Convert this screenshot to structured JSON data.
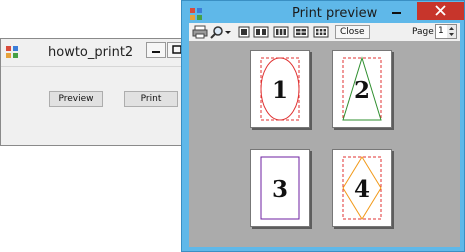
{
  "main_window": {
    "title": "howto_print2",
    "buttons": {
      "preview": "Preview",
      "print": "Print"
    }
  },
  "preview_window": {
    "title": "Print preview",
    "toolbar": {
      "close_label": "Close",
      "page_label": "Page",
      "page_value": "1"
    },
    "pages": [
      {
        "number": "1",
        "shape": "ellipse",
        "color": "#e03030"
      },
      {
        "number": "2",
        "shape": "triangle",
        "color": "#2f8f2f"
      },
      {
        "number": "3",
        "shape": "rectangle",
        "color": "#6d1fa0"
      },
      {
        "number": "4",
        "shape": "diamond",
        "color": "#f29a1a"
      }
    ],
    "margin_color": "#e03030"
  }
}
